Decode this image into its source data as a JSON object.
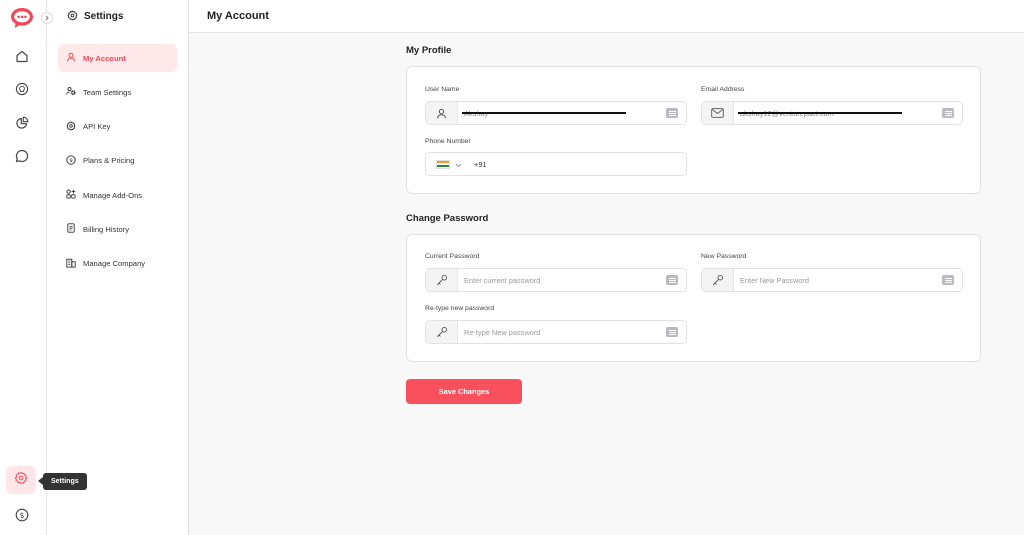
{
  "app": {
    "brand_color": "#f04a57"
  },
  "rail": {
    "items": [
      "home-icon",
      "bulb-icon",
      "chart-pie-icon",
      "chat-icon"
    ],
    "bottom": [
      "settings-icon",
      "dollar-icon"
    ],
    "tooltip": "Settings"
  },
  "sidebar": {
    "title": "Settings",
    "items": [
      {
        "label": "My Account",
        "icon": "user-icon",
        "active": true
      },
      {
        "label": "Team Settings",
        "icon": "team-icon"
      },
      {
        "label": "API Key",
        "icon": "gear-icon"
      },
      {
        "label": "Plans & Pricing",
        "icon": "dollar-icon"
      },
      {
        "label": "Manage Add-Ons",
        "icon": "addons-icon"
      },
      {
        "label": "Billing History",
        "icon": "document-icon"
      },
      {
        "label": "Manage Company",
        "icon": "building-icon"
      }
    ]
  },
  "header": {
    "title": "My Account"
  },
  "profile": {
    "title": "My Profile",
    "username": {
      "label": "User Name",
      "value": "Akshay"
    },
    "email": {
      "label": "Email Address",
      "value": "akshay12@venturepact.com"
    },
    "phone": {
      "label": "Phone Number",
      "code": "+91"
    }
  },
  "password": {
    "title": "Change Password",
    "current": {
      "label": "Current Password",
      "placeholder": "Enter current password"
    },
    "new": {
      "label": "New Password",
      "placeholder": "Enter New Password"
    },
    "retype": {
      "label": "Re-type new password",
      "placeholder": "Re-type New password"
    }
  },
  "actions": {
    "save": "Save Changes"
  }
}
